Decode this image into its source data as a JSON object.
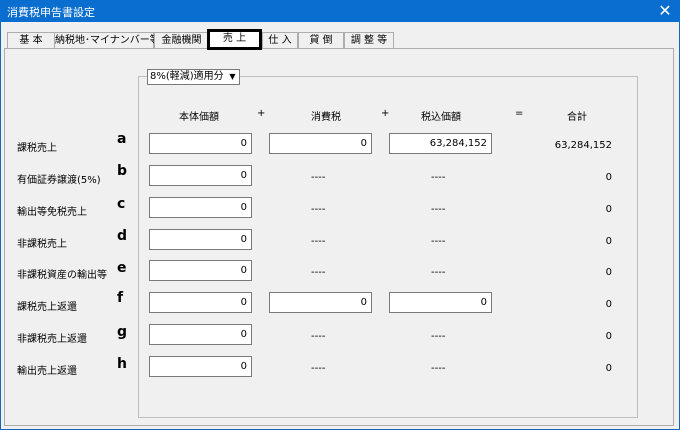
{
  "window": {
    "title": "消費税申告書設定",
    "close_glyph": "✕"
  },
  "tabs": [
    {
      "label": "基 本"
    },
    {
      "label": "納税地･マイナンバー等"
    },
    {
      "label": "金融機関"
    },
    {
      "label": "売 上"
    },
    {
      "label": "仕 入"
    },
    {
      "label": "貸 倒"
    },
    {
      "label": "調 整 等"
    }
  ],
  "rate_select": {
    "value": "8%(軽減)適用分"
  },
  "headers": {
    "base": "本体価額",
    "plus1": "+",
    "tax": "消費税",
    "plus2": "+",
    "incl": "税込価額",
    "eq": "=",
    "total": "合計"
  },
  "rows": [
    {
      "label": "課税売上",
      "letter": "a",
      "base": "0",
      "tax": "0",
      "incl": "63,284,152",
      "total": "63,284,152"
    },
    {
      "label": "有価証券譲渡(5%)",
      "letter": "b",
      "base": "0",
      "tax": "----",
      "incl": "----",
      "total": "0"
    },
    {
      "label": "輸出等免税売上",
      "letter": "c",
      "base": "0",
      "tax": "----",
      "incl": "----",
      "total": "0"
    },
    {
      "label": "非課税売上",
      "letter": "d",
      "base": "0",
      "tax": "----",
      "incl": "----",
      "total": "0"
    },
    {
      "label": "非課税資産の輸出等",
      "letter": "e",
      "base": "0",
      "tax": "----",
      "incl": "----",
      "total": "0"
    },
    {
      "label": "課税売上返還",
      "letter": "f",
      "base": "0",
      "tax": "0",
      "incl": "0",
      "total": "0"
    },
    {
      "label": "非課税売上返還",
      "letter": "g",
      "base": "0",
      "tax": "----",
      "incl": "----",
      "total": "0"
    },
    {
      "label": "輸出売上返還",
      "letter": "h",
      "base": "0",
      "tax": "----",
      "incl": "----",
      "total": "0"
    }
  ],
  "colors": {
    "titlebar": "#0a6ed1",
    "window_bg": "#f0f0f0"
  }
}
